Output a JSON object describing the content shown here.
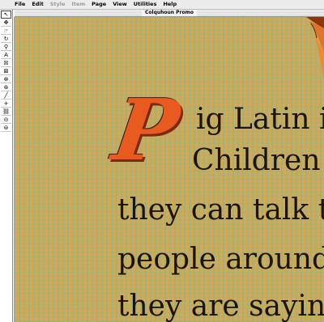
{
  "menubar": {
    "apple_glyph": "",
    "items": [
      {
        "label": "File",
        "enabled": true
      },
      {
        "label": "Edit",
        "enabled": true
      },
      {
        "label": "Style",
        "enabled": false
      },
      {
        "label": "Item",
        "enabled": false
      },
      {
        "label": "Page",
        "enabled": true
      },
      {
        "label": "View",
        "enabled": true
      },
      {
        "label": "Utilities",
        "enabled": true
      },
      {
        "label": "Help",
        "enabled": true
      }
    ]
  },
  "window": {
    "title": "Colquhoun Promo"
  },
  "tools": [
    {
      "name": "pointer-icon",
      "glyph": "↖"
    },
    {
      "name": "move-icon",
      "glyph": "✥"
    },
    {
      "name": "content-icon",
      "glyph": "☞"
    },
    {
      "name": "rotate-icon",
      "glyph": "↻"
    },
    {
      "name": "zoom-icon",
      "glyph": "⚲"
    },
    {
      "name": "text-box-icon",
      "glyph": "A"
    },
    {
      "name": "rect-picture-icon",
      "glyph": "☒"
    },
    {
      "name": "rounded-picture-icon",
      "glyph": "⊠"
    },
    {
      "name": "oval-picture-icon",
      "glyph": "⊗"
    },
    {
      "name": "bezier-picture-icon",
      "glyph": "⊛"
    },
    {
      "name": "line-icon",
      "glyph": "╱"
    },
    {
      "name": "orthogonal-line-icon",
      "glyph": "+"
    },
    {
      "name": "link-icon",
      "glyph": "⛓"
    },
    {
      "name": "unlink-icon",
      "glyph": "⊝"
    },
    {
      "name": "chain-icon",
      "glyph": "⊜"
    }
  ],
  "document": {
    "drop_cap": "P",
    "lines": [
      "ig Latin is",
      "Children l",
      "they can talk to",
      "people around t",
      "they are saying."
    ]
  },
  "colors": {
    "drop_cap": "#e85a1f",
    "canvas_base": "#d3aa4d",
    "text": "#1b140c"
  }
}
